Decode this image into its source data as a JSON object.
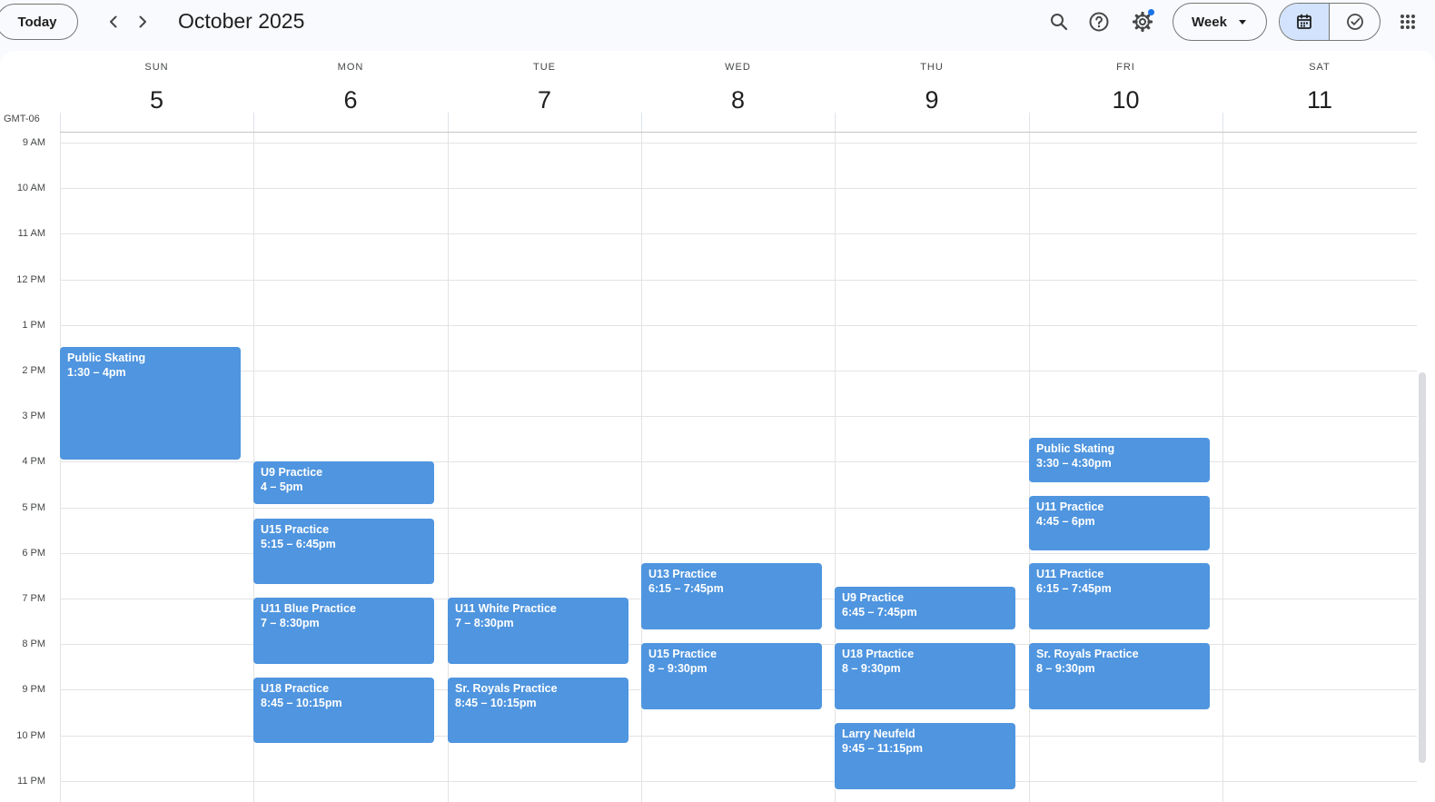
{
  "header": {
    "today_label": "Today",
    "month_title": "October 2025",
    "view_label": "Week"
  },
  "timezone": "GMT-06",
  "days": [
    {
      "name": "SUN",
      "num": "5"
    },
    {
      "name": "MON",
      "num": "6"
    },
    {
      "name": "TUE",
      "num": "7"
    },
    {
      "name": "WED",
      "num": "8"
    },
    {
      "name": "THU",
      "num": "9"
    },
    {
      "name": "FRI",
      "num": "10"
    },
    {
      "name": "SAT",
      "num": "11"
    }
  ],
  "hours": [
    "9 AM",
    "10 AM",
    "11 AM",
    "12 PM",
    "1 PM",
    "2 PM",
    "3 PM",
    "4 PM",
    "5 PM",
    "6 PM",
    "7 PM",
    "8 PM",
    "9 PM",
    "10 PM",
    "11 PM"
  ],
  "events": [
    {
      "title": "Public Skating",
      "time": "1:30 – 4pm"
    },
    {
      "title": "U9 Practice",
      "time": "4 – 5pm"
    },
    {
      "title": "U15 Practice",
      "time": "5:15 – 6:45pm"
    },
    {
      "title": "U11 Blue Practice",
      "time": "7 – 8:30pm"
    },
    {
      "title": "U18 Practice",
      "time": "8:45 – 10:15pm"
    },
    {
      "title": "U11 White Practice",
      "time": "7 – 8:30pm"
    },
    {
      "title": "Sr. Royals Practice",
      "time": "8:45 – 10:15pm"
    },
    {
      "title": "U13 Practice",
      "time": "6:15 – 7:45pm"
    },
    {
      "title": "U15 Practice",
      "time": "8 – 9:30pm"
    },
    {
      "title": "U9 Practice",
      "time": "6:45 – 7:45pm"
    },
    {
      "title": "U18 Prtactice",
      "time": "8 – 9:30pm"
    },
    {
      "title": "Larry Neufeld",
      "time": "9:45 – 11:15pm"
    },
    {
      "title": "Public Skating",
      "time": "3:30 – 4:30pm"
    },
    {
      "title": "U11 Practice",
      "time": "4:45 – 6pm"
    },
    {
      "title": "U11 Practice",
      "time": "6:15 – 7:45pm"
    },
    {
      "title": "Sr. Royals Practice",
      "time": "8 – 9:30pm"
    }
  ],
  "colors": {
    "event": "#4f95df",
    "accent": "#1a73e8",
    "toggle_active": "#d3e3fd"
  },
  "icons": [
    "chevron-left-icon",
    "chevron-right-icon",
    "search-icon",
    "help-icon",
    "gear-icon",
    "calendar-icon",
    "task-check-icon",
    "apps-grid-icon"
  ]
}
